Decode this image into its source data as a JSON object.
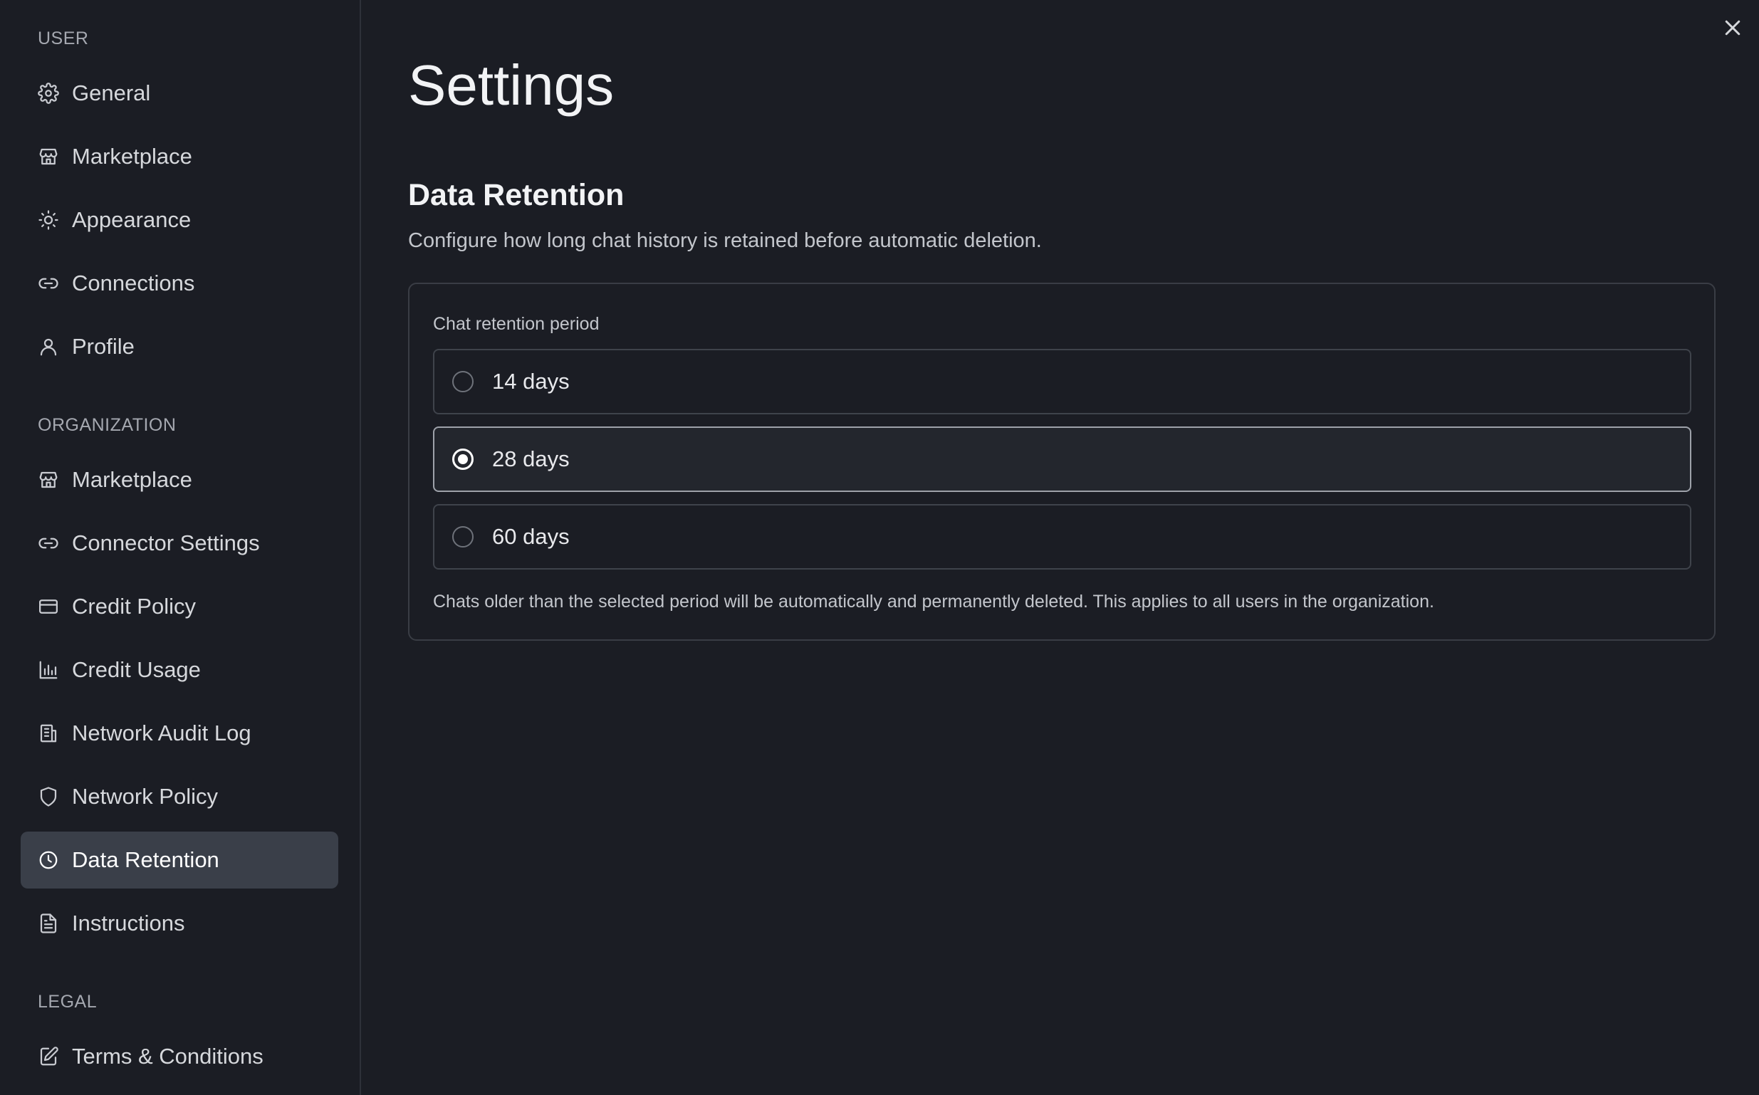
{
  "sidebar": {
    "user_label": "USER",
    "user_items": [
      {
        "label": "General",
        "icon": "gear-icon"
      },
      {
        "label": "Marketplace",
        "icon": "store-icon"
      },
      {
        "label": "Appearance",
        "icon": "sun-icon"
      },
      {
        "label": "Connections",
        "icon": "link-icon"
      },
      {
        "label": "Profile",
        "icon": "user-icon"
      }
    ],
    "org_label": "ORGANIZATION",
    "org_items": [
      {
        "label": "Marketplace",
        "icon": "store-icon"
      },
      {
        "label": "Connector Settings",
        "icon": "link-icon"
      },
      {
        "label": "Credit Policy",
        "icon": "credit-card-icon"
      },
      {
        "label": "Credit Usage",
        "icon": "bar-chart-icon"
      },
      {
        "label": "Network Audit Log",
        "icon": "building-icon"
      },
      {
        "label": "Network Policy",
        "icon": "shield-icon"
      },
      {
        "label": "Data Retention",
        "icon": "clock-icon",
        "active": true
      },
      {
        "label": "Instructions",
        "icon": "document-icon"
      }
    ],
    "legal_label": "LEGAL",
    "legal_items": [
      {
        "label": "Terms & Conditions",
        "icon": "edit-document-icon"
      }
    ]
  },
  "main": {
    "title": "Settings",
    "section_title": "Data Retention",
    "section_description": "Configure how long chat history is retained before automatic deletion.",
    "field_label": "Chat retention period",
    "options": [
      {
        "label": "14 days",
        "selected": false
      },
      {
        "label": "28 days",
        "selected": true
      },
      {
        "label": "60 days",
        "selected": false
      }
    ],
    "help_text": "Chats older than the selected period will be automatically and permanently deleted. This applies to all users in the organization."
  },
  "colors": {
    "background": "#1b1d24",
    "active_item": "#3a3f49",
    "border": "#3a3d45"
  }
}
